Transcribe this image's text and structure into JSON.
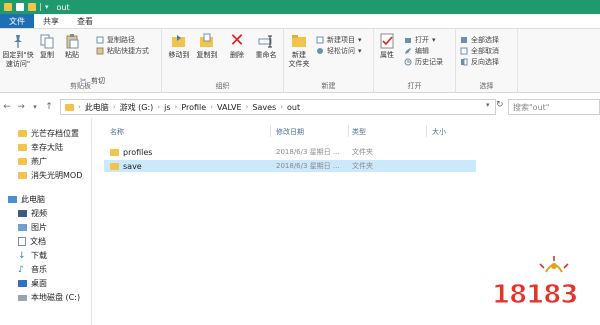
{
  "title_bar": {
    "title": "out"
  },
  "tabs": [
    "文件",
    "共享",
    "查看"
  ],
  "ribbon": {
    "pin_label": "固定到\"快\n速访问\"",
    "copy_label": "复制",
    "paste_label": "粘贴",
    "cut_label": "剪切",
    "copy_path_label": "复制路径",
    "paste_shortcut_label": "粘贴快捷方式",
    "group_clipboard": "剪贴板",
    "move_to_label": "移动到",
    "copy_to_label": "复制到",
    "delete_label": "删除",
    "rename_label": "重命名",
    "group_organize": "组织",
    "new_folder_label": "新建\n文件夹",
    "new_item_label": "新建项目",
    "easy_access_label": "轻松访问",
    "group_new": "新建",
    "properties_label": "属性",
    "open_label": "打开",
    "edit_label": "编辑",
    "history_label": "历史记录",
    "group_open": "打开",
    "select_all_label": "全部选择",
    "select_none_label": "全部取消",
    "invert_label": "反向选择",
    "group_select": "选择"
  },
  "address": {
    "crumbs": [
      "此电脑",
      "游戏 (G:)",
      "js",
      "Profile",
      "VALVE",
      "Saves",
      "out"
    ],
    "search_placeholder": "搜索\"out\""
  },
  "nav": {
    "items": [
      {
        "label": "光芒存档位置"
      },
      {
        "label": "幸存大陆"
      },
      {
        "label": "燕广"
      },
      {
        "label": "消失光明MOD"
      },
      {
        "label": "此电脑"
      },
      {
        "label": "视频"
      },
      {
        "label": "图片"
      },
      {
        "label": "文档"
      },
      {
        "label": "下载"
      },
      {
        "label": "音乐"
      },
      {
        "label": "桌面"
      },
      {
        "label": "本地磁盘 (C:)"
      }
    ]
  },
  "list": {
    "headers": {
      "name": "名称",
      "date": "修改日期",
      "type": "类型",
      "size": "大小"
    },
    "rows": [
      {
        "name": "profiles",
        "date": "2018/6/3 星期日 ...",
        "type": "文件夹"
      },
      {
        "name": "save",
        "date": "2018/6/3 星期日 ...",
        "type": "文件夹"
      }
    ]
  },
  "watermark": {
    "text": "18183"
  },
  "colors": {
    "title_bar": "#1f9a6f",
    "file_tab": "#1f6fb5",
    "selection": "#cce8fb",
    "folder": "#f3c44b",
    "watermark": "#e5332a"
  }
}
